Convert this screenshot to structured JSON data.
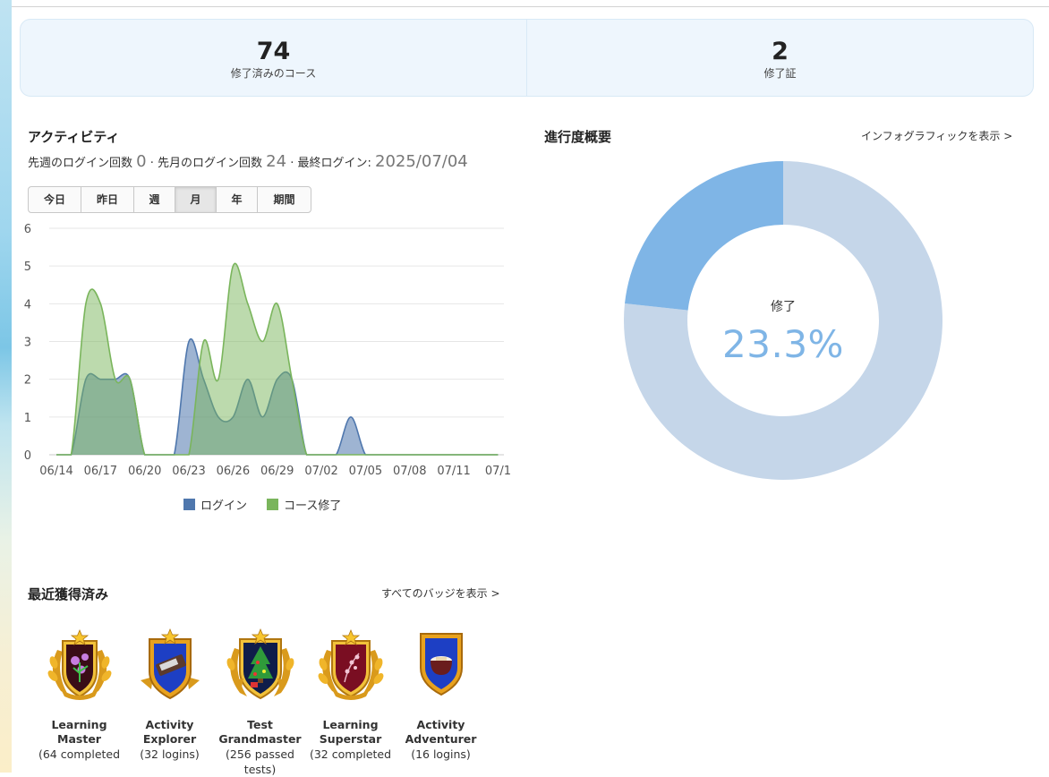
{
  "stats": [
    {
      "value": "74",
      "label": "修了済みのコース"
    },
    {
      "value": "2",
      "label": "修了証"
    }
  ],
  "activity": {
    "title": "アクティビティ",
    "last_week_label": "先週のログイン回数",
    "last_week_value": "0",
    "last_month_label": "· 先月のログイン回数",
    "last_month_value": "24",
    "last_login_label": "· 最終ログイン:",
    "last_login_value": "2025/07/04",
    "ranges": [
      "今日",
      "昨日",
      "週",
      "月",
      "年",
      "期間"
    ],
    "active_range": "月"
  },
  "chart_data": {
    "type": "area",
    "y_ticks": [
      "6",
      "5",
      "4",
      "3",
      "2",
      "1",
      "0"
    ],
    "ylim": [
      0,
      6
    ],
    "x_ticks": [
      "06/14",
      "06/17",
      "06/20",
      "06/23",
      "06/26",
      "06/29",
      "07/02",
      "07/05",
      "07/08",
      "07/11",
      "07/1"
    ],
    "x_days": [
      0,
      3,
      6,
      9,
      12,
      15,
      18,
      21,
      24,
      27,
      30
    ],
    "x_range": [
      0,
      30.4
    ],
    "grid": true,
    "legend_position": "bottom",
    "series": [
      {
        "name": "ログイン",
        "color": "#4f77ad",
        "points": [
          [
            0,
            0
          ],
          [
            1,
            0
          ],
          [
            2,
            2
          ],
          [
            3,
            2
          ],
          [
            4,
            2
          ],
          [
            5,
            2
          ],
          [
            6,
            0
          ],
          [
            7,
            0
          ],
          [
            8,
            0
          ],
          [
            9,
            3
          ],
          [
            10,
            2
          ],
          [
            11,
            1
          ],
          [
            12,
            1
          ],
          [
            13,
            2
          ],
          [
            14,
            1
          ],
          [
            15,
            2
          ],
          [
            16,
            2
          ],
          [
            17,
            0
          ],
          [
            18,
            0
          ],
          [
            19,
            0
          ],
          [
            20,
            1
          ],
          [
            21,
            0
          ],
          [
            22,
            0
          ],
          [
            23,
            0
          ],
          [
            24,
            0
          ],
          [
            25,
            0
          ],
          [
            26,
            0
          ],
          [
            27,
            0
          ],
          [
            28,
            0
          ],
          [
            29,
            0
          ],
          [
            30,
            0
          ]
        ]
      },
      {
        "name": "コース修了",
        "color": "#7ab55c",
        "points": [
          [
            0,
            0
          ],
          [
            1,
            0
          ],
          [
            2,
            4
          ],
          [
            3,
            4
          ],
          [
            4,
            2
          ],
          [
            5,
            2
          ],
          [
            6,
            0
          ],
          [
            7,
            0
          ],
          [
            8,
            0
          ],
          [
            9,
            0
          ],
          [
            10,
            3
          ],
          [
            11,
            2
          ],
          [
            12,
            5
          ],
          [
            13,
            4
          ],
          [
            14,
            3
          ],
          [
            15,
            4
          ],
          [
            16,
            2
          ],
          [
            17,
            0
          ],
          [
            18,
            0
          ],
          [
            19,
            0
          ],
          [
            20,
            0
          ],
          [
            21,
            0
          ],
          [
            22,
            0
          ],
          [
            23,
            0
          ],
          [
            24,
            0
          ],
          [
            25,
            0
          ],
          [
            26,
            0
          ],
          [
            27,
            0
          ],
          [
            28,
            0
          ],
          [
            29,
            0
          ],
          [
            30,
            0
          ]
        ]
      }
    ]
  },
  "progress": {
    "title": "進行度概要",
    "link": "インフォグラフィックを表示 >",
    "center_label": "修了",
    "center_value": "23.3%",
    "fraction": 0.233,
    "color_done": "#7fb5e6",
    "color_rest": "#c5d6e9"
  },
  "badges": {
    "title": "最近獲得済み",
    "link": "すべてのバッジを表示 >",
    "items": [
      {
        "name": "Learning Master",
        "desc": "(64 completed",
        "icon": "flower-laurel-badge-icon"
      },
      {
        "name": "Activity Explorer",
        "desc": "(32 logins)",
        "icon": "chocolate-shield-badge-icon"
      },
      {
        "name": "Test Grandmaster",
        "desc": "(256 passed tests)",
        "icon": "christmas-tree-laurel-badge-icon"
      },
      {
        "name": "Learning Superstar",
        "desc": "(32 completed",
        "icon": "blossom-laurel-badge-icon"
      },
      {
        "name": "Activity Adventurer",
        "desc": "(16 logins)",
        "icon": "bowl-shield-badge-icon"
      }
    ]
  }
}
